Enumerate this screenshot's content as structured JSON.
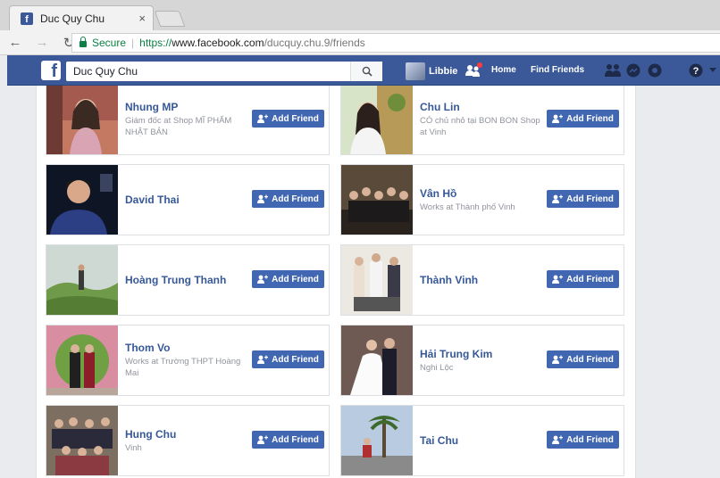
{
  "browser": {
    "tab_title": "Duc Quy Chu",
    "tab_close": "×",
    "secure_label": "Secure",
    "separator": "|",
    "url_scheme": "https://",
    "url_host": "www.facebook.com",
    "url_path": "/ducquy.chu.9/friends"
  },
  "fb_header": {
    "logo": "f",
    "search_value": "Duc Quy Chu",
    "profile_name": "Libbie",
    "home_label": "Home",
    "find_friends_label": "Find Friends"
  },
  "friends": [
    {
      "name": "Nhung MP",
      "sub": "Giám đốc at Shop MĨ PHẨM NHẬT BẢN",
      "button": "Add Friend"
    },
    {
      "name": "Chu Lin",
      "sub": "CÓ chủ nhỏ tại BON BON Shop at Vinh",
      "button": "Add Friend"
    },
    {
      "name": "David Thai",
      "sub": "",
      "button": "Add Friend"
    },
    {
      "name": "Vân Hồ",
      "sub": "Works at Thành phố Vinh",
      "button": "Add Friend"
    },
    {
      "name": "Hoàng Trung Thanh",
      "sub": "",
      "button": "Add Friend"
    },
    {
      "name": "Thành Vinh",
      "sub": "",
      "button": "Add Friend"
    },
    {
      "name": "Thom Vo",
      "sub": "Works at Trường THPT Hoàng Mai",
      "button": "Add Friend"
    },
    {
      "name": "Hải Trung Kim",
      "sub": "Nghi Lộc",
      "button": "Add Friend"
    },
    {
      "name": "Hung Chu",
      "sub": "Vinh",
      "button": "Add Friend"
    },
    {
      "name": "Tai Chu",
      "sub": "",
      "button": "Add Friend"
    }
  ],
  "colors": {
    "fb_blue": "#3b5998",
    "button_blue": "#4267b2",
    "name_link": "#365899"
  }
}
